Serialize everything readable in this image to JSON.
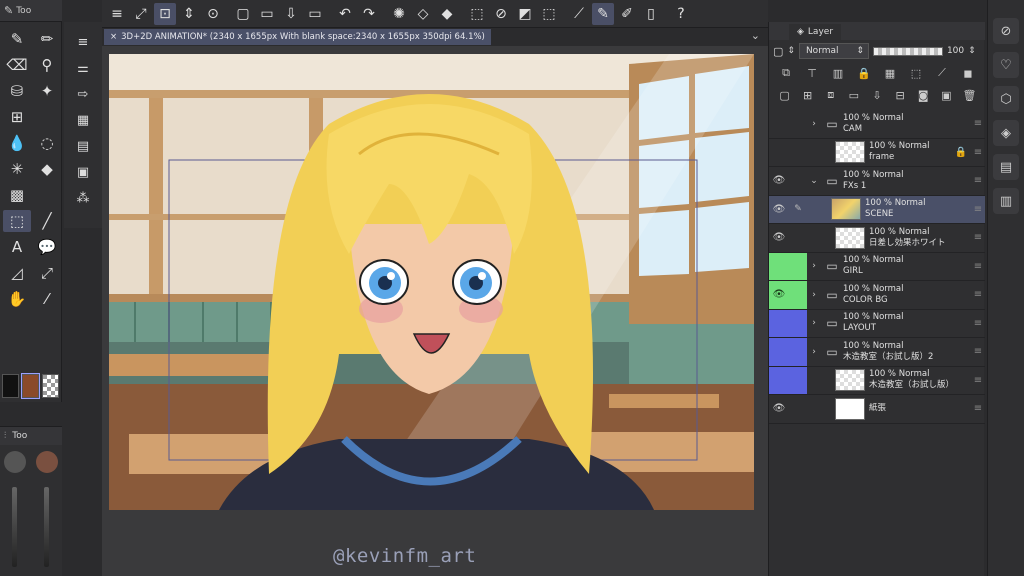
{
  "document": {
    "tab_title": "3D+2D ANIMATION* (2340 x 1655px With blank space:2340 x 1655px 350dpi 64.1%)"
  },
  "tool_palette": {
    "header": "Too",
    "sub_header": "Too",
    "tools": [
      {
        "name": "pen-tool-icon",
        "glyph": "✎"
      },
      {
        "name": "pencil-tool-icon",
        "glyph": "✏"
      },
      {
        "name": "eraser-tool-icon",
        "glyph": "⌫"
      },
      {
        "name": "dropper-tool-icon",
        "glyph": "⚲"
      },
      {
        "name": "fill-tool-icon",
        "glyph": "⛁"
      },
      {
        "name": "sparkle-tool-icon",
        "glyph": "✦"
      },
      {
        "name": "grid-tool-icon",
        "glyph": "⊞"
      },
      {
        "name": "blank-tool",
        "glyph": ""
      },
      {
        "name": "droplet-tool-icon",
        "glyph": "💧"
      },
      {
        "name": "lasso-tool-icon",
        "glyph": "◌"
      },
      {
        "name": "magic-wand-tool-icon",
        "glyph": "✳"
      },
      {
        "name": "bucket-tool-icon",
        "glyph": "◆"
      },
      {
        "name": "gradient-tool-icon",
        "glyph": "▩"
      },
      {
        "name": "blank-tool-2",
        "glyph": ""
      },
      {
        "name": "select-tool-icon",
        "glyph": "⬚"
      },
      {
        "name": "line-tool-icon",
        "glyph": "╱"
      },
      {
        "name": "text-tool-icon",
        "glyph": "A"
      },
      {
        "name": "balloon-tool-icon",
        "glyph": "💬"
      },
      {
        "name": "frame-tool-icon",
        "glyph": "◿"
      },
      {
        "name": "operation-tool-icon",
        "glyph": "⤢"
      },
      {
        "name": "hand-tool-icon",
        "glyph": "✋"
      },
      {
        "name": "eyedropper-tool-icon",
        "glyph": "⁄"
      }
    ],
    "colors": {
      "main": "#111111",
      "sub": "#8a4a2a",
      "transparent": "checker"
    }
  },
  "command_bar": {
    "icons": [
      "menu-icon",
      "fit-icon",
      "zoom-icon",
      "chevrons-icon",
      "view-icon",
      "new-icon",
      "open-icon",
      "save-icon",
      "export-icon",
      "undo-icon",
      "redo-icon",
      "loading-icon",
      "clear-icon",
      "fill-icon",
      "transform-icon",
      "deselect-icon",
      "invert-icon",
      "bound-icon",
      "ruler-icon",
      "brush-icon",
      "pen-icon",
      "page-icon",
      "help-icon"
    ]
  },
  "layer_panel": {
    "tab_label": "Layer",
    "blend_mode": "Normal",
    "opacity": "100",
    "layers": [
      {
        "vis": "",
        "vis_color": "",
        "lock": "",
        "kind": "folder",
        "expanded": false,
        "line1": "100 % Normal",
        "line2": "CAM",
        "selected": false
      },
      {
        "vis": "",
        "vis_color": "",
        "lock": "",
        "kind": "raster",
        "thumb": "checker",
        "line1": "100 % Normal",
        "line2": "frame",
        "extra": "🔒",
        "selected": false
      },
      {
        "vis": "👁",
        "vis_color": "",
        "lock": "",
        "kind": "folder",
        "expanded": true,
        "line1": "100 % Normal",
        "line2": "FXs 1",
        "selected": false
      },
      {
        "vis": "👁",
        "vis_color": "",
        "lock": "✎",
        "kind": "raster",
        "thumb": "scene",
        "line1": "100 % Normal",
        "line2": "SCENE",
        "selected": true
      },
      {
        "vis": "👁",
        "vis_color": "",
        "lock": "",
        "kind": "raster",
        "thumb": "checker",
        "line1": "100 % Normal",
        "line2": "日差し効果ホワイト",
        "selected": false
      },
      {
        "vis": "",
        "vis_color": "green",
        "lock": "",
        "kind": "folder",
        "expanded": false,
        "line1": "100 % Normal",
        "line2": "GIRL",
        "selected": false
      },
      {
        "vis": "👁",
        "vis_color": "green",
        "lock": "",
        "kind": "folder",
        "expanded": false,
        "line1": "100 % Normal",
        "line2": "COLOR BG",
        "selected": false
      },
      {
        "vis": "",
        "vis_color": "blue",
        "lock": "",
        "kind": "folder",
        "expanded": false,
        "line1": "100 % Normal",
        "line2": "LAYOUT",
        "selected": false
      },
      {
        "vis": "",
        "vis_color": "blue",
        "lock": "",
        "kind": "folder",
        "expanded": false,
        "line1": "100 % Normal",
        "line2": "木造教室（お試し版）2",
        "selected": false
      },
      {
        "vis": "",
        "vis_color": "blue",
        "lock": "",
        "kind": "raster",
        "thumb": "checker",
        "line1": "100 % Normal",
        "line2": "木造教室（お試し版）",
        "selected": false
      },
      {
        "vis": "👁",
        "vis_color": "",
        "lock": "",
        "kind": "raster",
        "thumb": "white",
        "line1": "",
        "line2": "紙張",
        "selected": false
      }
    ]
  },
  "watermark": "@kevinfm_art",
  "colors": {
    "accent": "#4a5068",
    "green": "#6fe07a",
    "blue": "#5b63e0",
    "hair": "#f2d36b"
  }
}
